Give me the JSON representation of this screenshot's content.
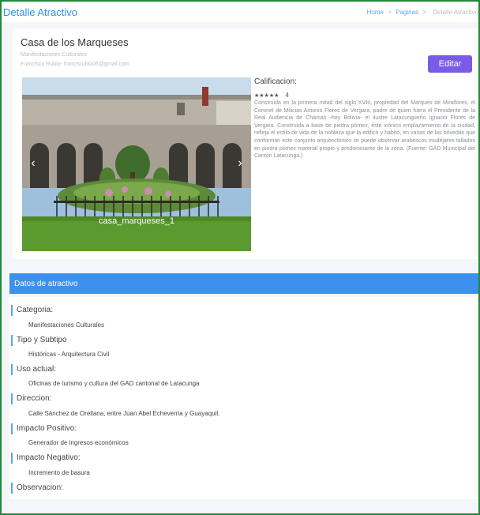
{
  "header": {
    "page_title": "Detalle Atractivo",
    "breadcrumbs": [
      "Home",
      "Paginas",
      "Detalle Atractivo"
    ],
    "separator": ">"
  },
  "attraction": {
    "name": "Casa de los Marqueses",
    "category_subtitle": "Manifestaciones Culturales",
    "author": "Francisco Rubio- francisrubio06@gmail.com",
    "edit_label": "Editar",
    "image_caption": "casa_marqueses_1",
    "rating_title": "Calificacion:",
    "stars": "★★★★★",
    "rating_value": "4",
    "description": "Construida en la primera mitad del siglo XVIII, propiedad del Marques de Miraflores, el Coronel de Milicias Antonio Flores de Vergara, padre de quien fuera el Presidente de la Real Audiencia de Charcas -hoy Bolivia- el ilustre Latacungueño Ignacio Flores de Vergara. Construida a base de piedra pómez, éste icónico emplazamiento de la ciudad, refleja el estilo de vida de la nobleza que la edificó y habitó, en varias de las bóvedas que conforman este conjunto arquitectónico se puede observar arabescos mudéjares tallados en piedra pómez material propio y predominante de la zona. (Fuente: GAD Municipal del Cantón Latacunga.)"
  },
  "details": {
    "section_title": "Datos de atractivo",
    "fields": [
      {
        "label": "Categoria:",
        "value": "Manifestaciones Culturales"
      },
      {
        "label": "Tipo y Subtipo",
        "value": "Históricas - Arquitectura Civil"
      },
      {
        "label": "Uso actual:",
        "value": "Oficinas de turismo y cultura del GAD cantonal de Latacunga"
      },
      {
        "label": "Direccion:",
        "value": "Calle Sánchez de Orellana, entre Juan Abel Echeverria y Guayaquil."
      },
      {
        "label": "Impacto Positivo:",
        "value": "Generador de ingresos económicos"
      },
      {
        "label": "Impacto Negativo:",
        "value": "Incremento de basura"
      },
      {
        "label": "Observacion:",
        "value": ""
      }
    ]
  },
  "colors": {
    "accent": "#2d8fe6",
    "section_bar": "#3e90f0",
    "edit_button": "#7a5be6",
    "frame_border": "#1f8a3a"
  },
  "icons": [
    "chevron-left-icon",
    "chevron-right-icon",
    "star-icon"
  ]
}
